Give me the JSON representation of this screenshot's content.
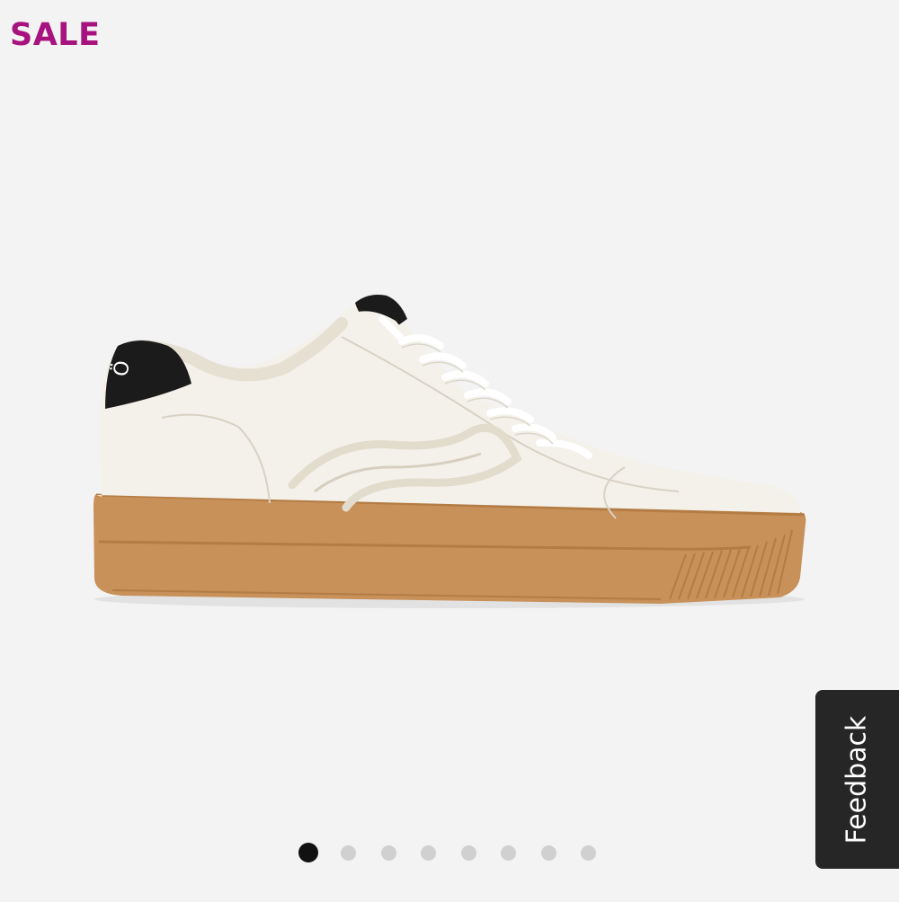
{
  "badge": {
    "label": "SALE",
    "color": "#a8127f"
  },
  "product_image": {
    "alt": "",
    "description_icon": "white-sneaker-gum-sole",
    "colors": {
      "upper": "#f4f1ea",
      "heel_tab": "#1b1b1b",
      "sole": "#c8915a"
    }
  },
  "carousel": {
    "total_slides": 8,
    "active_index": 0
  },
  "feedback": {
    "label": "Feedback",
    "background": "#262626"
  }
}
